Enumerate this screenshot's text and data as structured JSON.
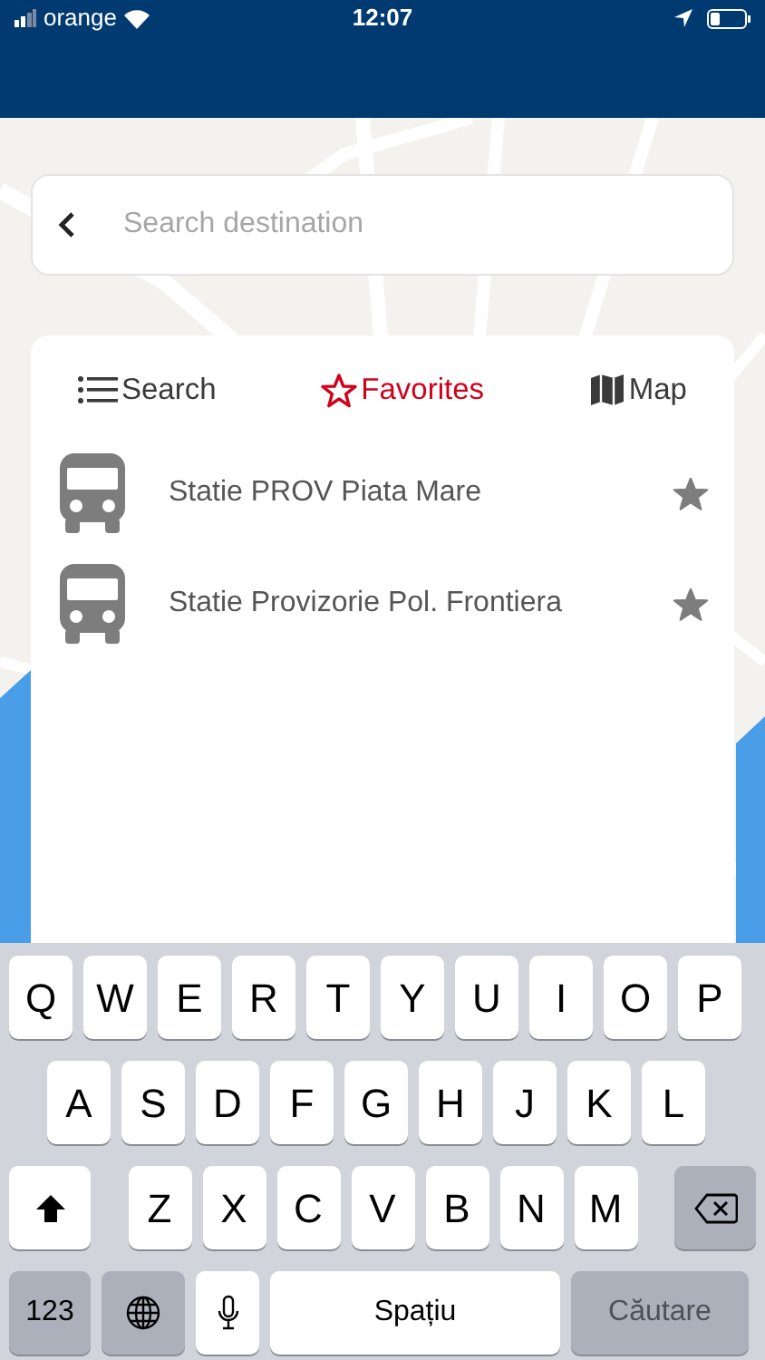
{
  "status_bar": {
    "carrier": "orange",
    "time": "12:07"
  },
  "search": {
    "placeholder": "Search destination"
  },
  "tabs": [
    {
      "kind": "list",
      "label": "Search",
      "selected": false
    },
    {
      "kind": "star",
      "label": "Favorites",
      "selected": true
    },
    {
      "kind": "map",
      "label": "Map",
      "selected": false
    }
  ],
  "favorites": [
    {
      "name": "Statie PROV Piata Mare",
      "starred": true
    },
    {
      "name": "Statie Provizorie Pol. Frontiera",
      "starred": true
    }
  ],
  "keyboard": {
    "rows": [
      {
        "keys": [
          {
            "kind": "letter",
            "label": "Q"
          },
          {
            "kind": "letter",
            "label": "W"
          },
          {
            "kind": "letter",
            "label": "E"
          },
          {
            "kind": "letter",
            "label": "R"
          },
          {
            "kind": "letter",
            "label": "T"
          },
          {
            "kind": "letter",
            "label": "Y"
          },
          {
            "kind": "letter",
            "label": "U"
          },
          {
            "kind": "letter",
            "label": "I"
          },
          {
            "kind": "letter",
            "label": "O"
          },
          {
            "kind": "letter",
            "label": "P"
          }
        ]
      },
      {
        "keys": [
          {
            "kind": "letter",
            "label": "A"
          },
          {
            "kind": "letter",
            "label": "S"
          },
          {
            "kind": "letter",
            "label": "D"
          },
          {
            "kind": "letter",
            "label": "F"
          },
          {
            "kind": "letter",
            "label": "G"
          },
          {
            "kind": "letter",
            "label": "H"
          },
          {
            "kind": "letter",
            "label": "J"
          },
          {
            "kind": "letter",
            "label": "K"
          },
          {
            "kind": "letter",
            "label": "L"
          }
        ]
      },
      {
        "keys": [
          {
            "kind": "shift"
          },
          {
            "kind": "letter",
            "label": "Z"
          },
          {
            "kind": "letter",
            "label": "X"
          },
          {
            "kind": "letter",
            "label": "C"
          },
          {
            "kind": "letter",
            "label": "V"
          },
          {
            "kind": "letter",
            "label": "B"
          },
          {
            "kind": "letter",
            "label": "N"
          },
          {
            "kind": "letter",
            "label": "M"
          },
          {
            "kind": "delete"
          }
        ]
      },
      {
        "keys": [
          {
            "kind": "mode",
            "label": "123"
          },
          {
            "kind": "globe"
          },
          {
            "kind": "mic"
          },
          {
            "kind": "space",
            "label": "Spațiu"
          },
          {
            "kind": "action",
            "label": "Căutare",
            "disabled": true
          }
        ]
      }
    ]
  }
}
